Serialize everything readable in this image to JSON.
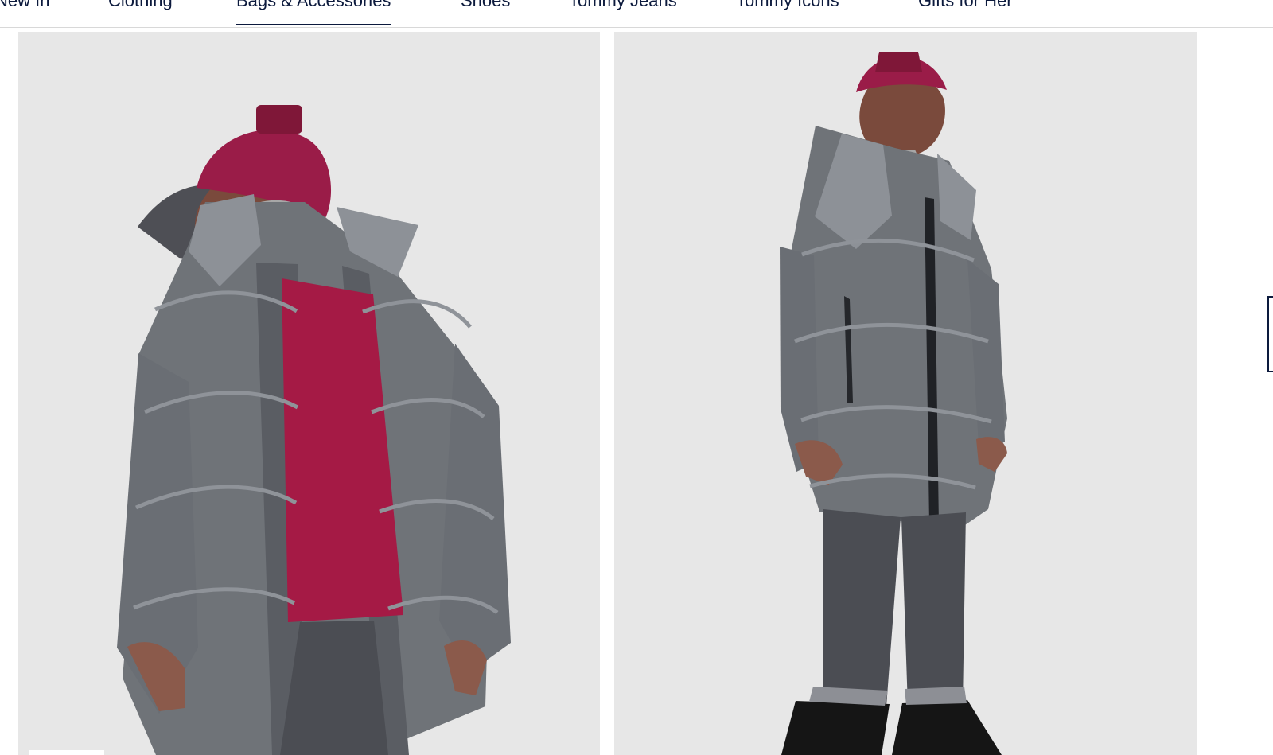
{
  "nav": {
    "items": [
      {
        "label": "New In"
      },
      {
        "label": "Clothing"
      },
      {
        "label": "Bags & Accessories"
      },
      {
        "label": "Shoes"
      },
      {
        "label": "Tommy Jeans"
      },
      {
        "label": "Tommy Icons"
      },
      {
        "label": "Gifts for Her"
      }
    ],
    "active_index": 2
  },
  "colors": {
    "navy": "#0c1a3d",
    "image_bg": "#e7e7e7",
    "jacket": "#6f7378",
    "beanie": "#9a1c48",
    "shirt": "#a51a45",
    "sweater": "#a7a7a7",
    "jeans": "#4b4d53",
    "boots": "#151515"
  },
  "gallery": {
    "images": [
      {
        "name": "product-photo-front"
      },
      {
        "name": "product-photo-side"
      }
    ]
  }
}
